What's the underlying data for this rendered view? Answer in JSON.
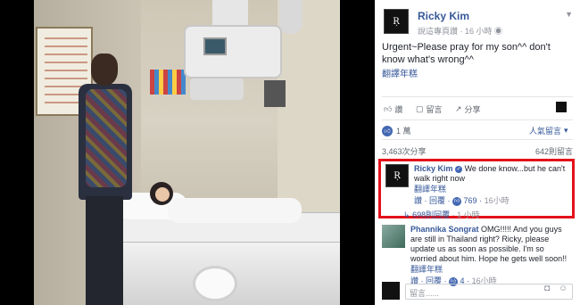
{
  "post": {
    "author": "Ricky Kim",
    "page_label": "說這專頁讚",
    "time": "16 小時",
    "text": "Urgent~Please pray for my son^^ don't know what's wrong^^",
    "see_translation": "翻譯年糕",
    "avatar_icon": "ricky-kim-logo"
  },
  "actions": {
    "like": "讚",
    "comment": "留言",
    "share": "分享",
    "sort": "人氣留言"
  },
  "stats": {
    "likes": "1 萬",
    "shares": "3,463次分享",
    "comments": "642則留言"
  },
  "comments": [
    {
      "author": "Ricky Kim",
      "text": "We done know...but he can't walk right now",
      "see_translation": "翻譯年糕",
      "like": "讚",
      "reply": "回覆",
      "likes": "769",
      "time": "16小時",
      "replies": "698則回覆",
      "replies_time": "1 小時"
    },
    {
      "author": "Phannika Songrat",
      "text": "OMG!!!!! And you guys are still in Thailand right? Ricky, please update us as soon as possible. I'm so worried about him. Hope he gets well soon!!",
      "see_translation": "翻譯年糕",
      "like": "讚",
      "reply": "回覆",
      "likes": "4",
      "time": "16小時"
    }
  ],
  "compose": {
    "placeholder": "留言......"
  },
  "colors": {
    "link": "#365899",
    "highlight": "#e3111a"
  }
}
